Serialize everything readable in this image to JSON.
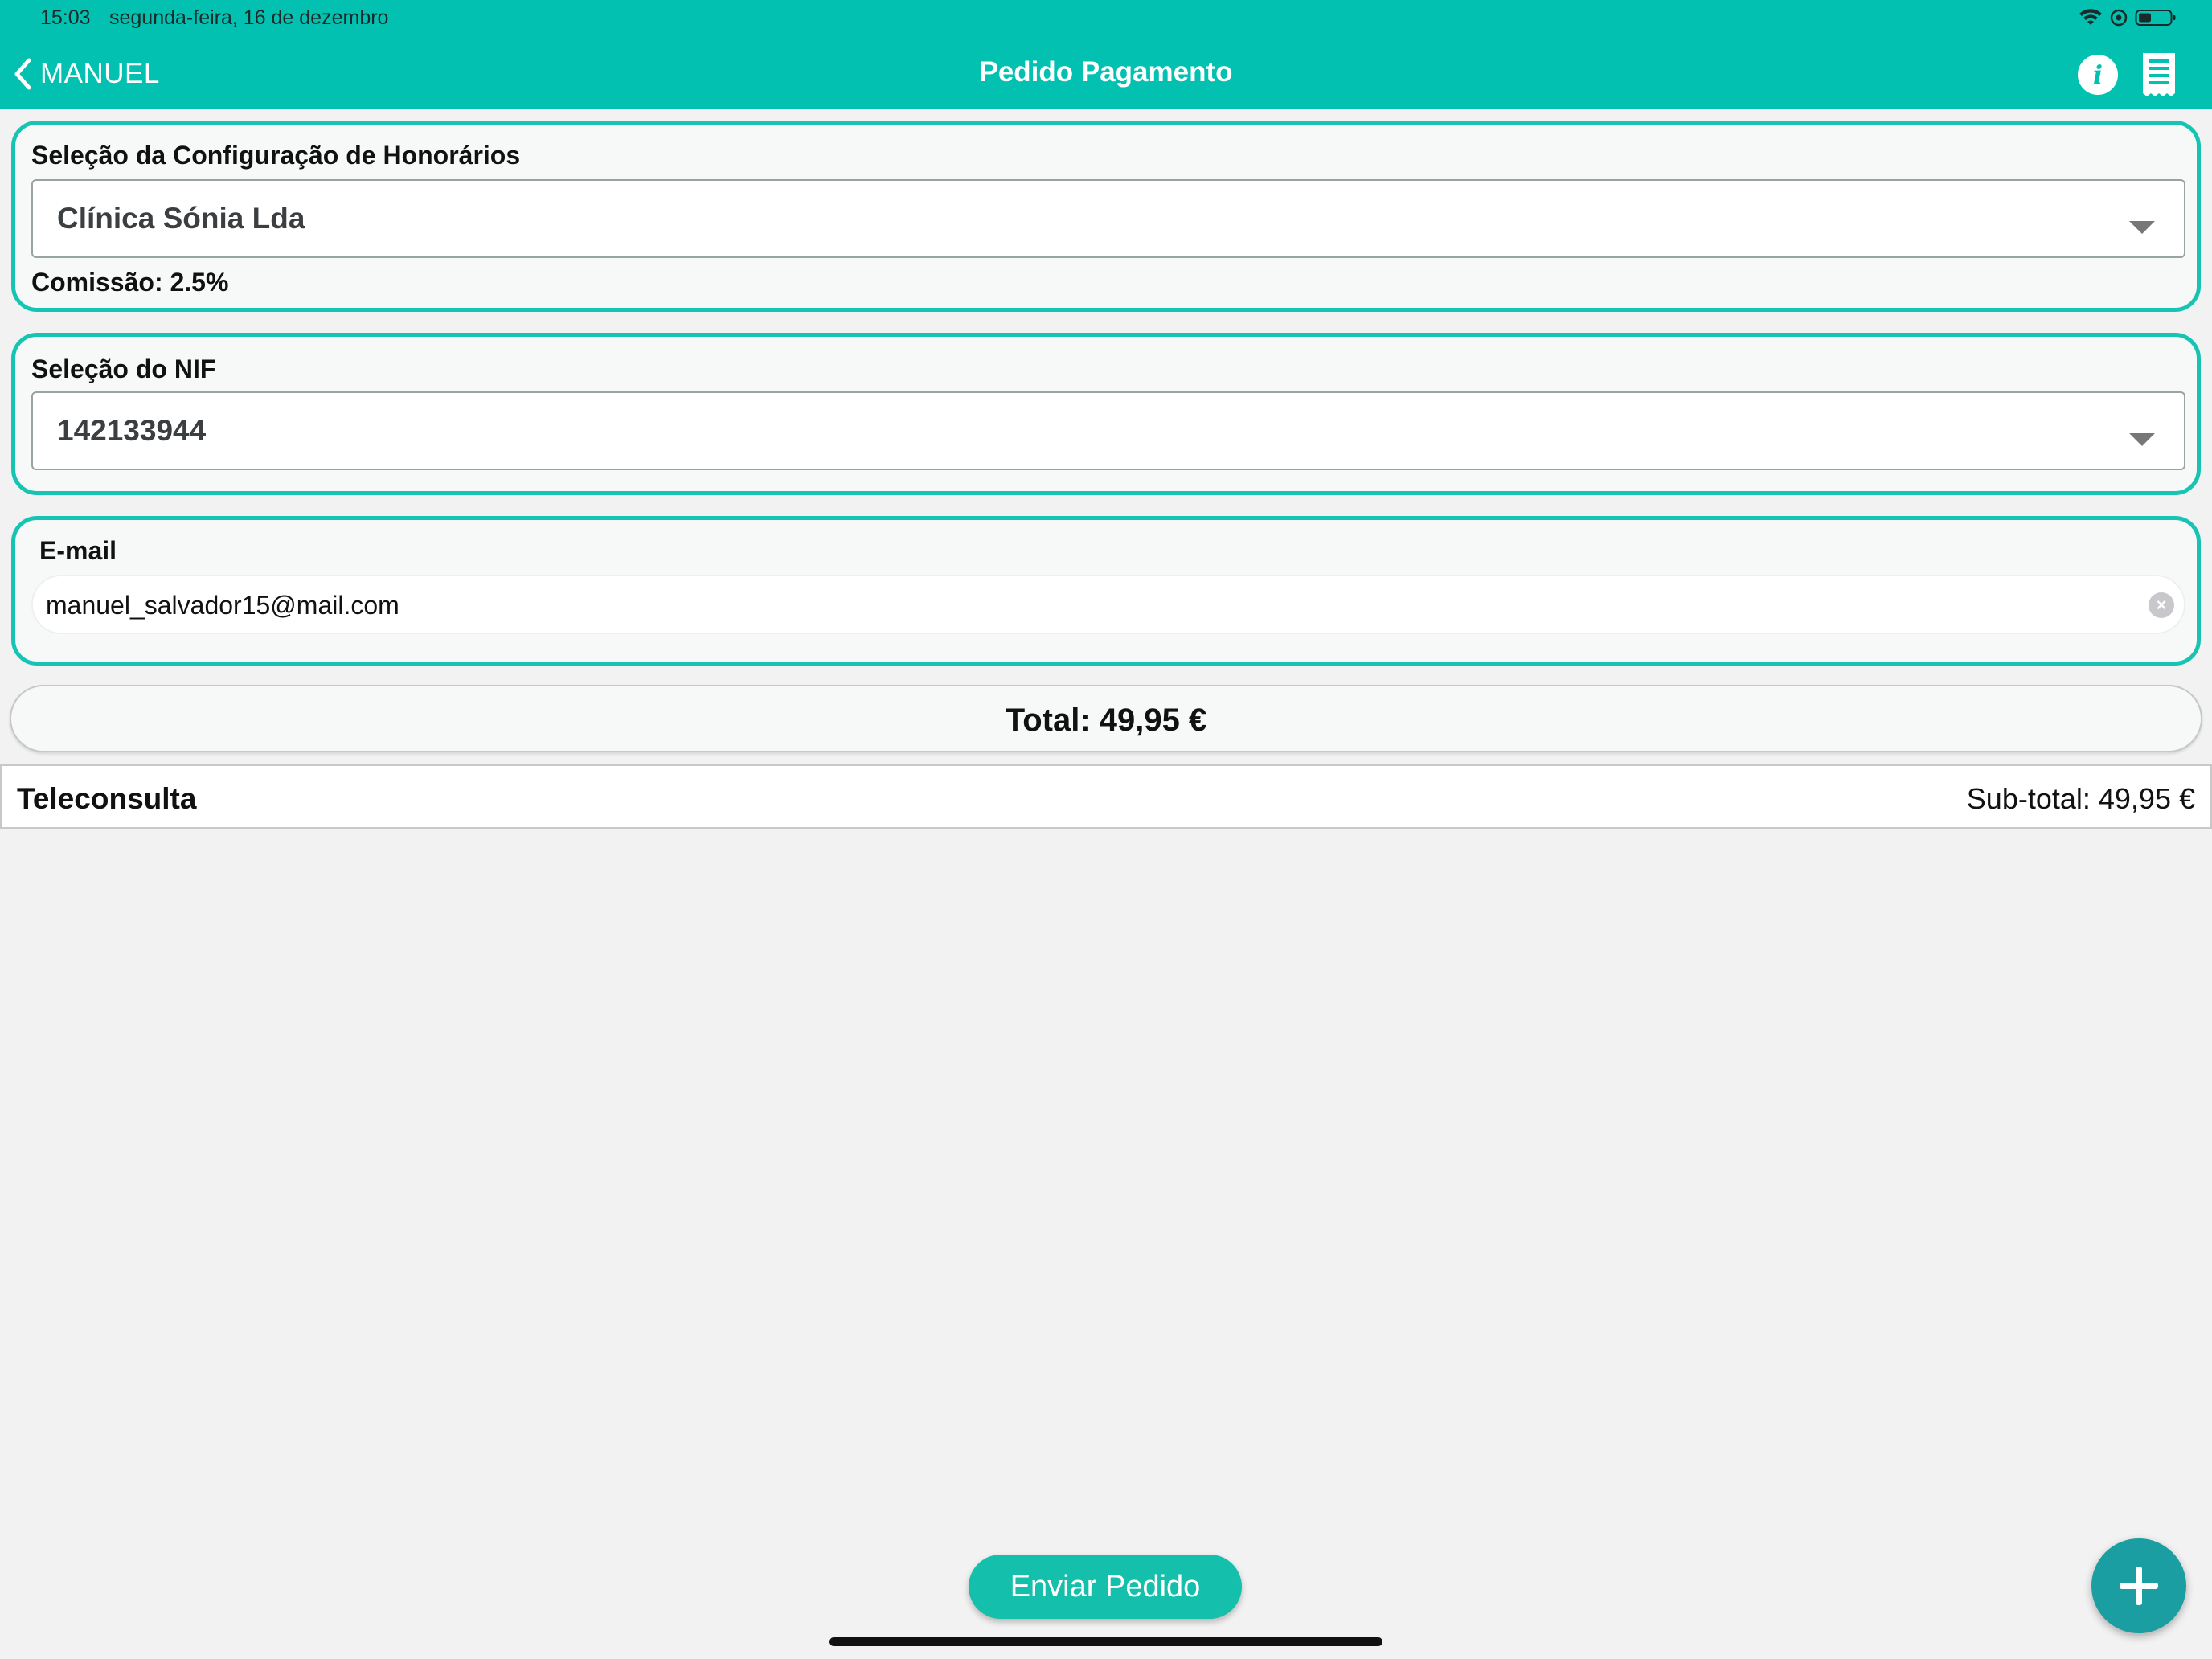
{
  "status_bar": {
    "time": "15:03",
    "date": "segunda-feira, 16 de dezembro"
  },
  "nav": {
    "back_label": "MANUEL",
    "title": "Pedido Pagamento",
    "icons": [
      "chevron-left-icon",
      "info-icon",
      "receipt-icon"
    ]
  },
  "fee_config": {
    "label": "Seleção da Configuração de Honorários",
    "selected": "Clínica Sónia Lda",
    "commission": "Comissão: 2.5%"
  },
  "nif": {
    "label": "Seleção do NIF",
    "selected": "142133944"
  },
  "email": {
    "label": "E-mail",
    "value": "manuel_salvador15@mail.com"
  },
  "total": {
    "text": "Total: 49,95 €"
  },
  "items": [
    {
      "name": "Teleconsulta",
      "subtotal": "Sub-total: 49,95 €"
    }
  ],
  "actions": {
    "send_label": "Enviar Pedido"
  },
  "colors": {
    "accent": "#03c1b0",
    "card_border": "#17c4b4",
    "fab": "#1a9ea1",
    "background": "#f2f2f2"
  }
}
